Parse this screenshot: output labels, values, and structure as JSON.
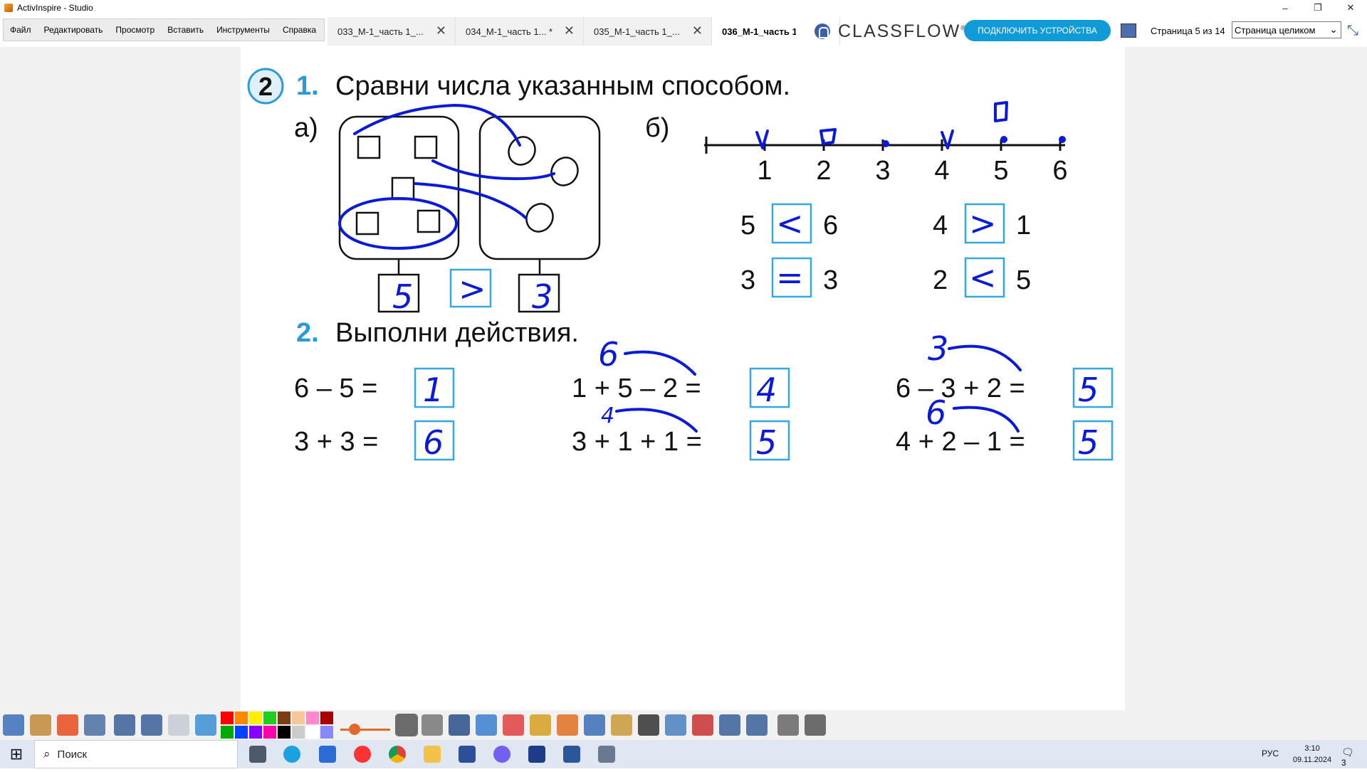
{
  "window": {
    "title": "ActivInspire - Studio",
    "controls": [
      "–",
      "❐",
      "✕"
    ]
  },
  "menu": [
    "Файл",
    "Редактировать",
    "Просмотр",
    "Вставить",
    "Инструменты",
    "Справка"
  ],
  "tabs": [
    {
      "label": "033_М-1_часть 1_...",
      "active": false
    },
    {
      "label": "034_М-1_часть 1... *",
      "active": false
    },
    {
      "label": "035_М-1_часть 1_...",
      "active": false
    },
    {
      "label": "036_М-1_часть 1",
      "active": true
    }
  ],
  "classflow": {
    "logo": "CLASSFLOW",
    "tm": "®",
    "connect_label": "ПОДКЛЮЧИТЬ УСТРОЙСТВА",
    "page_info": "Страница 5 из 14",
    "zoom_value": "Страница целиком"
  },
  "worksheet": {
    "badge": "2",
    "task1": {
      "num": "1.",
      "title": "Сравни числа указанным способом."
    },
    "part_a": "а)",
    "part_b": "б)",
    "number_line": [
      "1",
      "2",
      "3",
      "4",
      "5",
      "6"
    ],
    "compare_a": {
      "left": "5",
      "sign": ">",
      "right": "3"
    },
    "compare_b": [
      {
        "left": "5",
        "sign": "<",
        "right": "6"
      },
      {
        "left": "4",
        "sign": ">",
        "right": "1"
      },
      {
        "left": "3",
        "sign": "=",
        "right": "3"
      },
      {
        "left": "2",
        "sign": "<",
        "right": "5"
      }
    ],
    "task2": {
      "num": "2.",
      "title": "Выполни действия."
    },
    "expressions": [
      {
        "text": "6 – 5 =",
        "answer": "1",
        "note": ""
      },
      {
        "text": "3 + 3 =",
        "answer": "6",
        "note": ""
      },
      {
        "text": "1 + 5 – 2 =",
        "answer": "4",
        "note": "6"
      },
      {
        "text": "3 + 1 + 1 =",
        "answer": "5",
        "note": "4"
      },
      {
        "text": "6 – 3 + 2 =",
        "answer": "5",
        "note": "3"
      },
      {
        "text": "4 + 2 – 1 =",
        "answer": "5",
        "note": "6"
      }
    ],
    "colors": {
      "ink": "#0a1ad6",
      "answer_box": "#35a7e0",
      "accent": "#2a9ad8"
    }
  },
  "taskbar": {
    "search_placeholder": "Поиск",
    "lang": "РУС",
    "time": "3:10",
    "date": "09.11.2024",
    "notifications": "3"
  },
  "toolbar_icons": [
    "menu-icon",
    "profile-icon",
    "pen-red-icon",
    "design-icon",
    "prev-page-icon",
    "next-page-icon",
    "play-icon",
    "browser-icon",
    "select-icon",
    "tools-icon",
    "pen-icon",
    "highlighter-icon",
    "eraser-icon",
    "fill-icon",
    "shape-icon",
    "connector-icon",
    "folder-icon",
    "text-icon",
    "clear-icon",
    "reset-icon",
    "undo-icon",
    "redo-icon",
    "more-icon",
    "desktop-annotate-icon"
  ],
  "palette_colors": [
    "#ff0000",
    "#ff8800",
    "#ffee00",
    "#22cc22",
    "#7a3e11",
    "#f7c79a",
    "#ff88cc",
    "#aa0000",
    "#00aa00",
    "#0044ff",
    "#8800ff",
    "#ff00aa",
    "#000000",
    "#cccccc",
    "#ffffff",
    "#8888ff"
  ]
}
